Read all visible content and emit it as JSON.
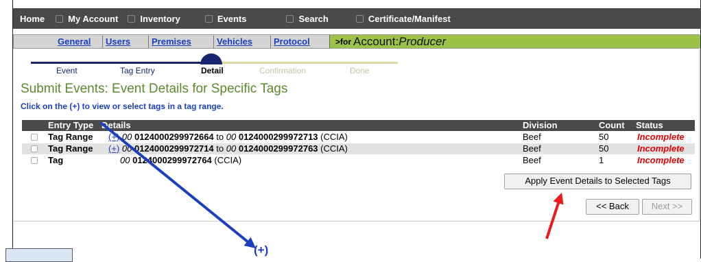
{
  "nav": {
    "items": [
      {
        "label": "Home"
      },
      {
        "label": "My Account"
      },
      {
        "label": "Inventory"
      },
      {
        "label": "Events"
      },
      {
        "label": "Search"
      },
      {
        "label": "Certificate/Manifest"
      }
    ]
  },
  "subnav": {
    "tabs": [
      "General",
      "Users",
      "Premises",
      "Vehicles",
      "Protocol"
    ],
    "account_prefix": ">for",
    "account_label": "Account:",
    "account_value": "Producer"
  },
  "wizard": {
    "steps": [
      "Event",
      "Tag Entry",
      "Detail",
      "Confirmation",
      "Done"
    ],
    "current": "Detail"
  },
  "page": {
    "title": "Submit Events: Event Details for Specific Tags",
    "instruction": "Click on the (+) to view or select tags in a tag range."
  },
  "table": {
    "headers": {
      "entry_type": "Entry Type",
      "details": "Details",
      "division": "Division",
      "count": "Count",
      "status": "Status"
    },
    "rows": [
      {
        "entry_type": "Tag Range",
        "expand": "(+)",
        "from_prefix": "00",
        "from_tag": "0124000299972664",
        "to_word": "to",
        "to_prefix": "00",
        "to_tag": "0124000299972713",
        "suffix": "(CCIA)",
        "division": "Beef",
        "count": "50",
        "status": "Incomplete"
      },
      {
        "entry_type": "Tag Range",
        "expand": "(+)",
        "from_prefix": "00",
        "from_tag": "0124000299972714",
        "to_word": "to",
        "to_prefix": "00",
        "to_tag": "0124000299972763",
        "suffix": "(CCIA)",
        "division": "Beef",
        "count": "50",
        "status": "Incomplete"
      },
      {
        "entry_type": "Tag",
        "from_prefix": "00",
        "from_tag": "0124000299972764",
        "suffix": "(CCIA)",
        "division": "Beef",
        "count": "1",
        "status": "Incomplete"
      }
    ]
  },
  "actions": {
    "apply_label": "Apply Event Details to Selected Tags",
    "back_label": "<< Back",
    "next_label": "Next >>"
  },
  "annotation": {
    "callout_text": "(+)",
    "blue_arrow_color": "#1a3fbf",
    "red_arrow_color": "#e81c1c"
  },
  "colors": {
    "nav_bg": "#4a4a4a",
    "account_bar": "#9cc24a",
    "title_green": "#5a8a2e",
    "link_blue": "#1a3fbf",
    "status_red": "#e00000",
    "wizard_navy": "#16256e"
  }
}
